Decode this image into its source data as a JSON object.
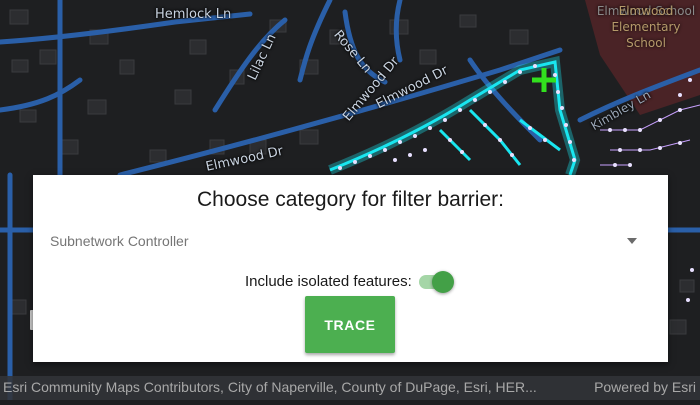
{
  "map": {
    "street_labels": [
      "Hemlock Ln",
      "Lilac Ln",
      "Rose Ln",
      "Elmwood Dr",
      "Elmwood Dr",
      "Elmwood Dr",
      "Kimbley Ln"
    ],
    "school_label_line1": "Elmwood School",
    "school_label_line2": "Elmwood",
    "school_label_line3": "Elementary",
    "school_label_line4": "School",
    "colors": {
      "background": "#1e1f21",
      "road": "#2a5fa8",
      "utility_glow": "#19e6f0",
      "trace_marker": "#32e01e",
      "lot_outline": "#3a3b3e",
      "school_fill": "#5a2a2a"
    },
    "marker_icon": "plus-icon"
  },
  "dialog": {
    "title": "Choose category for filter barrier:",
    "category_selected": "Subnetwork Controller",
    "isolated_label": "Include isolated features:",
    "isolated_enabled": true,
    "trace_button": "TRACE",
    "accent_color": "#4caf50"
  },
  "attribution": {
    "text": "Esri Community Maps Contributors, City of Naperville, County of DuPage, Esri, HER...",
    "powered_by": "Powered by Esri"
  }
}
